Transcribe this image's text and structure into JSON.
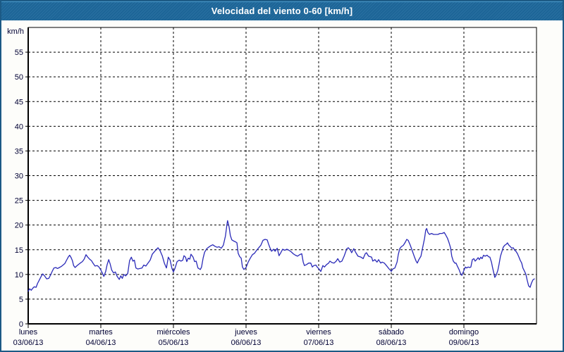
{
  "window": {
    "title": "Velocidad del viento 0-60 [km/h]"
  },
  "colors": {
    "titlebar_bg": "#1e689c",
    "titlebar_highlight": "#4b9bcd",
    "titlebar_text": "#ffffff",
    "frame_border": "#1c5a85",
    "content_bg": "#fdfdfa",
    "plot_bg": "#ffffff",
    "plot_border": "#000000",
    "grid": "#000000",
    "line": "#2a2ab8",
    "label_text": "#000033"
  },
  "chart_data": {
    "type": "line",
    "title": "Velocidad del viento 0-60 [km/h]",
    "ylabel": "km/h",
    "xlabel": "",
    "ylim": [
      0,
      60
    ],
    "xlim": [
      0,
      168
    ],
    "x_unit": "hours from Monday 00:00",
    "grid": "dashed",
    "legend": "none",
    "y_ticks": [
      0,
      5,
      10,
      15,
      20,
      25,
      30,
      35,
      40,
      45,
      50,
      55
    ],
    "days": [
      {
        "name": "lunes",
        "date": "03/06/13",
        "hour": 0
      },
      {
        "name": "martes",
        "date": "04/06/13",
        "hour": 24
      },
      {
        "name": "miércoles",
        "date": "05/06/13",
        "hour": 48
      },
      {
        "name": "jueves",
        "date": "06/06/13",
        "hour": 72
      },
      {
        "name": "viernes",
        "date": "07/06/13",
        "hour": 96
      },
      {
        "name": "sábado",
        "date": "08/06/13",
        "hour": 120
      },
      {
        "name": "domingo",
        "date": "09/06/13",
        "hour": 144
      }
    ],
    "series": [
      {
        "name": "velocidad del viento",
        "points": [
          [
            0,
            6.6
          ],
          [
            0.5,
            7.1
          ],
          [
            1,
            6.8
          ],
          [
            1.5,
            7.2
          ],
          [
            2,
            7.5
          ],
          [
            2.6,
            7.4
          ],
          [
            3.1,
            8.2
          ],
          [
            3.6,
            8.8
          ],
          [
            4.2,
            9.5
          ],
          [
            4.8,
            10.1
          ],
          [
            5.4,
            9.7
          ],
          [
            6.1,
            9.1
          ],
          [
            6.8,
            9.2
          ],
          [
            7.4,
            9.9
          ],
          [
            8,
            10.7
          ],
          [
            8.5,
            11.3
          ],
          [
            9.1,
            11.4
          ],
          [
            9.7,
            11.2
          ],
          [
            10.3,
            11.4
          ],
          [
            10.9,
            11.6
          ],
          [
            11.5,
            11.9
          ],
          [
            12.1,
            12.2
          ],
          [
            12.7,
            12.9
          ],
          [
            13.2,
            13.5
          ],
          [
            13.7,
            13.9
          ],
          [
            14.2,
            13.4
          ],
          [
            14.6,
            12.8
          ],
          [
            15,
            11.8
          ],
          [
            15.5,
            11.4
          ],
          [
            16,
            11.7
          ],
          [
            16.6,
            12
          ],
          [
            17.2,
            12.3
          ],
          [
            17.9,
            12.6
          ],
          [
            18.5,
            13.1
          ],
          [
            19.1,
            14
          ],
          [
            19.7,
            13.5
          ],
          [
            20.3,
            13.1
          ],
          [
            20.9,
            12.8
          ],
          [
            21.5,
            12.2
          ],
          [
            22.1,
            11.7
          ],
          [
            22.8,
            11.8
          ],
          [
            23.4,
            11.5
          ],
          [
            24,
            10.9
          ],
          [
            24.5,
            10.3
          ],
          [
            25,
            9.6
          ],
          [
            25.6,
            10.6
          ],
          [
            26.1,
            12
          ],
          [
            26.6,
            13
          ],
          [
            27.1,
            12.1
          ],
          [
            27.6,
            10.9
          ],
          [
            28.2,
            10.3
          ],
          [
            28.8,
            10.5
          ],
          [
            29.4,
            9.6
          ],
          [
            30.1,
            9
          ],
          [
            30.6,
            9.7
          ],
          [
            31.1,
            9.2
          ],
          [
            31.6,
            10
          ],
          [
            32.2,
            9.7
          ],
          [
            32.9,
            10.2
          ],
          [
            33.5,
            12.8
          ],
          [
            34.1,
            13.5
          ],
          [
            34.6,
            12.7
          ],
          [
            35.1,
            12.9
          ],
          [
            35.6,
            11.3
          ],
          [
            36.2,
            11.1
          ],
          [
            36.9,
            11.2
          ],
          [
            37.6,
            11.3
          ],
          [
            38.2,
            11.9
          ],
          [
            38.9,
            11.7
          ],
          [
            39.6,
            12.3
          ],
          [
            40.3,
            12.9
          ],
          [
            41,
            14.1
          ],
          [
            41.7,
            14.6
          ],
          [
            42.4,
            15.1
          ],
          [
            42.9,
            15.4
          ],
          [
            43.6,
            14.8
          ],
          [
            44.3,
            13.8
          ],
          [
            45,
            12.3
          ],
          [
            45.7,
            11.3
          ],
          [
            46.3,
            13.5
          ],
          [
            46.9,
            12.9
          ],
          [
            47.5,
            11.2
          ],
          [
            48,
            10.5
          ],
          [
            48.5,
            11.2
          ],
          [
            49.2,
            12.6
          ],
          [
            49.9,
            12.9
          ],
          [
            50.5,
            12.7
          ],
          [
            51.1,
            12.9
          ],
          [
            51.5,
            13.8
          ],
          [
            52,
            13.5
          ],
          [
            52.4,
            12.6
          ],
          [
            52.9,
            13.3
          ],
          [
            53.4,
            13.1
          ],
          [
            53.8,
            14.1
          ],
          [
            54.5,
            13.5
          ],
          [
            55,
            12.6
          ],
          [
            55.5,
            12.7
          ],
          [
            56.1,
            11.3
          ],
          [
            56.9,
            11
          ],
          [
            57.3,
            11.5
          ],
          [
            57.8,
            13.3
          ],
          [
            58.3,
            14.5
          ],
          [
            59,
            15.2
          ],
          [
            59.6,
            15.5
          ],
          [
            60.3,
            15.8
          ],
          [
            61,
            16
          ],
          [
            61.7,
            15.7
          ],
          [
            62.4,
            15.5
          ],
          [
            63.1,
            15.6
          ],
          [
            63.8,
            15.3
          ],
          [
            64.5,
            15.9
          ],
          [
            65.2,
            17.8
          ],
          [
            65.7,
            20.2
          ],
          [
            65.9,
            20.9
          ],
          [
            66.4,
            19.6
          ],
          [
            66.8,
            17.9
          ],
          [
            67.3,
            17
          ],
          [
            67.8,
            16.8
          ],
          [
            68.5,
            16.6
          ],
          [
            69,
            16.4
          ],
          [
            69.4,
            14.3
          ],
          [
            69.9,
            13.6
          ],
          [
            70.4,
            13.3
          ],
          [
            70.8,
            11.5
          ],
          [
            71.3,
            11
          ],
          [
            72,
            11.4
          ],
          [
            72.7,
            12.5
          ],
          [
            73.4,
            13.3
          ],
          [
            74.1,
            14
          ],
          [
            74.8,
            14.3
          ],
          [
            75.5,
            14.9
          ],
          [
            76.2,
            15.4
          ],
          [
            76.9,
            15.9
          ],
          [
            77.6,
            16.9
          ],
          [
            78.3,
            17.1
          ],
          [
            79,
            17
          ],
          [
            79.4,
            16.2
          ],
          [
            79.9,
            15.4
          ],
          [
            80.4,
            14.7
          ],
          [
            81.1,
            15.1
          ],
          [
            81.6,
            14.7
          ],
          [
            82.3,
            15.3
          ],
          [
            82.9,
            13.8
          ],
          [
            83.4,
            14.3
          ],
          [
            84.1,
            15.1
          ],
          [
            84.8,
            14.9
          ],
          [
            85.5,
            15.1
          ],
          [
            86.2,
            14.9
          ],
          [
            86.9,
            14.6
          ],
          [
            87.6,
            14.2
          ],
          [
            88.3,
            13.9
          ],
          [
            89,
            13.7
          ],
          [
            89.7,
            14
          ],
          [
            90.4,
            14.2
          ],
          [
            90.9,
            12.5
          ],
          [
            91.3,
            11.8
          ],
          [
            92,
            12
          ],
          [
            92.7,
            12.3
          ],
          [
            93.4,
            12.3
          ],
          [
            93.9,
            11.5
          ],
          [
            94.4,
            11.8
          ],
          [
            95.1,
            11.9
          ],
          [
            95.5,
            11.5
          ],
          [
            96,
            11.2
          ],
          [
            96.7,
            10.6
          ],
          [
            97.4,
            11.8
          ],
          [
            97.9,
            11.5
          ],
          [
            98.6,
            12
          ],
          [
            99.3,
            12.3
          ],
          [
            99.7,
            12.7
          ],
          [
            100.4,
            12.4
          ],
          [
            101.1,
            12.3
          ],
          [
            101.8,
            12.7
          ],
          [
            102.3,
            13.2
          ],
          [
            103,
            12.5
          ],
          [
            103.7,
            12.7
          ],
          [
            104.4,
            13.7
          ],
          [
            105.3,
            15.2
          ],
          [
            105.8,
            15.4
          ],
          [
            106.5,
            14.9
          ],
          [
            106.9,
            14.4
          ],
          [
            107.6,
            15.2
          ],
          [
            108.3,
            14.4
          ],
          [
            109,
            13.7
          ],
          [
            110,
            13.5
          ],
          [
            110.7,
            13.2
          ],
          [
            111.4,
            14.2
          ],
          [
            111.8,
            14.4
          ],
          [
            112.5,
            13.7
          ],
          [
            113.5,
            13.5
          ],
          [
            113.9,
            12.7
          ],
          [
            114.6,
            13
          ],
          [
            115.3,
            12.5
          ],
          [
            115.8,
            13
          ],
          [
            116.5,
            12.3
          ],
          [
            117,
            12.5
          ],
          [
            117.7,
            12.3
          ],
          [
            118.4,
            11.8
          ],
          [
            119.3,
            11.1
          ],
          [
            119.8,
            10.8
          ],
          [
            120,
            10.6
          ],
          [
            120.5,
            11.1
          ],
          [
            121.2,
            11.3
          ],
          [
            121.9,
            12.5
          ],
          [
            122.3,
            14
          ],
          [
            122.8,
            15.2
          ],
          [
            123.3,
            15.6
          ],
          [
            124,
            15.9
          ],
          [
            124.7,
            16.6
          ],
          [
            125.1,
            17.1
          ],
          [
            125.6,
            16.9
          ],
          [
            126.3,
            15.9
          ],
          [
            127,
            14.7
          ],
          [
            127.7,
            13.5
          ],
          [
            128.2,
            12.7
          ],
          [
            128.6,
            12.3
          ],
          [
            129.1,
            13
          ],
          [
            129.8,
            13.7
          ],
          [
            130.3,
            15.2
          ],
          [
            131,
            17.3
          ],
          [
            131.4,
            19
          ],
          [
            131.7,
            19.3
          ],
          [
            132.1,
            18.5
          ],
          [
            132.6,
            18.1
          ],
          [
            133.3,
            18.3
          ],
          [
            134,
            18.1
          ],
          [
            134.7,
            18.1
          ],
          [
            135.4,
            18.1
          ],
          [
            136.1,
            18.3
          ],
          [
            136.8,
            18.3
          ],
          [
            137.5,
            18.5
          ],
          [
            137.9,
            18.1
          ],
          [
            138.6,
            17.3
          ],
          [
            139.1,
            16.4
          ],
          [
            139.6,
            15.4
          ],
          [
            140,
            13.7
          ],
          [
            140.5,
            12.7
          ],
          [
            141,
            12.3
          ],
          [
            141.4,
            12.3
          ],
          [
            141.9,
            11.6
          ],
          [
            142.4,
            11
          ],
          [
            142.8,
            10.3
          ],
          [
            143.3,
            9.8
          ],
          [
            144,
            10.8
          ],
          [
            144.5,
            11.5
          ],
          [
            144.9,
            11.3
          ],
          [
            145.4,
            11.5
          ],
          [
            145.9,
            11.4
          ],
          [
            146.3,
            11.5
          ],
          [
            146.8,
            13
          ],
          [
            147.3,
            13.2
          ],
          [
            147.7,
            12.7
          ],
          [
            148.2,
            13
          ],
          [
            148.7,
            13.4
          ],
          [
            149.1,
            13
          ],
          [
            149.6,
            13.5
          ],
          [
            150,
            13.2
          ],
          [
            150.5,
            13.9
          ],
          [
            151,
            13.7
          ],
          [
            151.7,
            13.9
          ],
          [
            152.1,
            13.6
          ],
          [
            152.6,
            13.5
          ],
          [
            153.1,
            12.5
          ],
          [
            153.5,
            11.3
          ],
          [
            154,
            10
          ],
          [
            154.2,
            9.4
          ],
          [
            154.7,
            9.9
          ],
          [
            155.2,
            10.8
          ],
          [
            155.6,
            12
          ],
          [
            156.1,
            13.7
          ],
          [
            156.6,
            14.7
          ],
          [
            157,
            15.5
          ],
          [
            157.5,
            15.9
          ],
          [
            158,
            16.1
          ],
          [
            158.4,
            16.4
          ],
          [
            158.9,
            15.9
          ],
          [
            159.4,
            15.6
          ],
          [
            159.8,
            15.3
          ],
          [
            160.3,
            15.4
          ],
          [
            160.8,
            14.9
          ],
          [
            161.2,
            14.7
          ],
          [
            161.7,
            14.2
          ],
          [
            162.2,
            13.5
          ],
          [
            162.6,
            12.9
          ],
          [
            163.1,
            12.3
          ],
          [
            163.5,
            11.3
          ],
          [
            164,
            10.7
          ],
          [
            164.5,
            10
          ],
          [
            164.9,
            8.9
          ],
          [
            165.4,
            7.7
          ],
          [
            165.9,
            7.4
          ],
          [
            166.3,
            8.2
          ],
          [
            166.8,
            8.9
          ],
          [
            167.3,
            9.1
          ]
        ]
      }
    ]
  }
}
